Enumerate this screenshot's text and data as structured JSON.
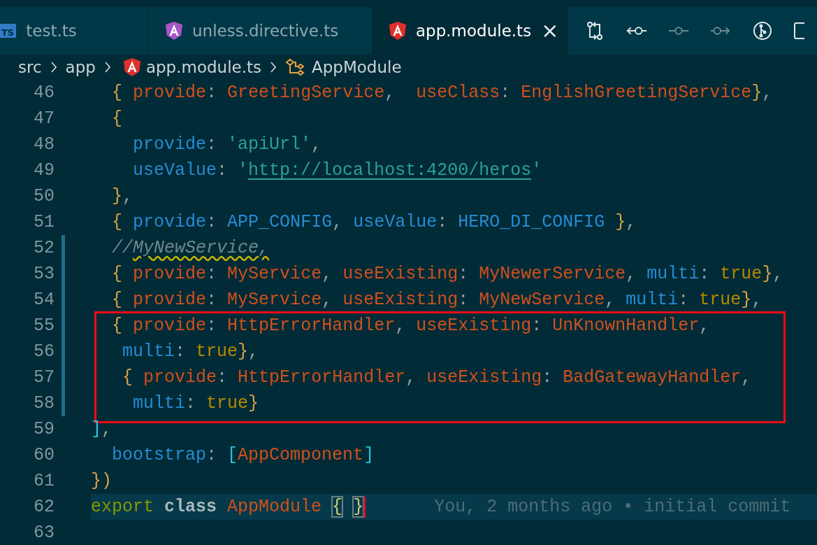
{
  "tabs": [
    {
      "label": "test.ts",
      "icon": {
        "kind": "ts",
        "text": "TS"
      },
      "selected": false
    },
    {
      "label": "unless.directive.ts",
      "icon": {
        "kind": "angular",
        "color": "#a855c8"
      },
      "selected": false
    },
    {
      "label": "app.module.ts",
      "icon": {
        "kind": "angular",
        "color": "#e0302a"
      },
      "selected": true,
      "close": "×"
    }
  ],
  "toolbar": [
    {
      "kind": "compare",
      "disabled": false
    },
    {
      "kind": "back",
      "disabled": false
    },
    {
      "kind": "commit",
      "disabled": true
    },
    {
      "kind": "forward",
      "disabled": true
    },
    {
      "kind": "graph",
      "disabled": false
    },
    {
      "kind": "split",
      "disabled": false
    }
  ],
  "breadcrumb": [
    {
      "label": "src",
      "kind": "folder"
    },
    {
      "label": "app",
      "kind": "folder"
    },
    {
      "label": "app.module.ts",
      "kind": "file"
    },
    {
      "label": "AppModule",
      "kind": "symbol"
    }
  ],
  "lines": [
    {
      "num": "46",
      "kind": "provider",
      "modified": false,
      "boxed": false,
      "current": false,
      "text": "  { provide: GreetingService,  useClass: EnglishGreetingService},"
    },
    {
      "num": "47",
      "kind": "object",
      "modified": false,
      "boxed": false,
      "current": false,
      "text": "  {"
    },
    {
      "num": "48",
      "kind": "object",
      "modified": false,
      "boxed": false,
      "current": false,
      "text": "    provide: 'apiUrl',"
    },
    {
      "num": "49",
      "kind": "link",
      "modified": false,
      "boxed": false,
      "current": false,
      "text": "    useValue: 'http://localhost:4200/heros'"
    },
    {
      "num": "50",
      "kind": "object",
      "modified": false,
      "boxed": false,
      "current": false,
      "text": "  },"
    },
    {
      "num": "51",
      "kind": "object",
      "modified": false,
      "boxed": false,
      "current": false,
      "text": "  { provide: APP_CONFIG, useValue: HERO_DI_CONFIG },"
    },
    {
      "num": "52",
      "kind": "comment",
      "modified": true,
      "boxed": false,
      "current": false,
      "text": "  //MyNewService,"
    },
    {
      "num": "53",
      "kind": "provider",
      "modified": true,
      "boxed": false,
      "current": false,
      "text": "  { provide: MyService, useExisting: MyNewerService, multi: true},"
    },
    {
      "num": "54",
      "kind": "provider",
      "modified": true,
      "boxed": false,
      "current": false,
      "text": "  { provide: MyService, useExisting: MyNewService, multi: true},"
    },
    {
      "num": "55",
      "kind": "provider",
      "modified": true,
      "boxed": true,
      "current": false,
      "text": "  { provide: HttpErrorHandler, useExisting: UnKnownHandler,"
    },
    {
      "num": "56",
      "kind": "object",
      "modified": true,
      "boxed": true,
      "current": false,
      "text": "   multi: true},"
    },
    {
      "num": "57",
      "kind": "provider",
      "modified": true,
      "boxed": true,
      "current": false,
      "text": "   { provide: HttpErrorHandler, useExisting: BadGatewayHandler,"
    },
    {
      "num": "58",
      "kind": "object",
      "modified": true,
      "boxed": true,
      "current": false,
      "text": "    multi: true}"
    },
    {
      "num": "59",
      "kind": "object",
      "modified": false,
      "boxed": false,
      "current": false,
      "text": "],"
    },
    {
      "num": "60",
      "kind": "object",
      "modified": false,
      "boxed": false,
      "current": false,
      "text": "  bootstrap: [AppComponent]"
    },
    {
      "num": "61",
      "kind": "object",
      "modified": false,
      "boxed": false,
      "current": false,
      "text": "})"
    },
    {
      "num": "62",
      "kind": "declaration",
      "modified": false,
      "boxed": false,
      "current": true,
      "blame": "You, 2 months ago • initial commit",
      "text": "export class AppModule { }"
    },
    {
      "num": "63",
      "modified": false,
      "boxed": false,
      "current": false
    }
  ]
}
